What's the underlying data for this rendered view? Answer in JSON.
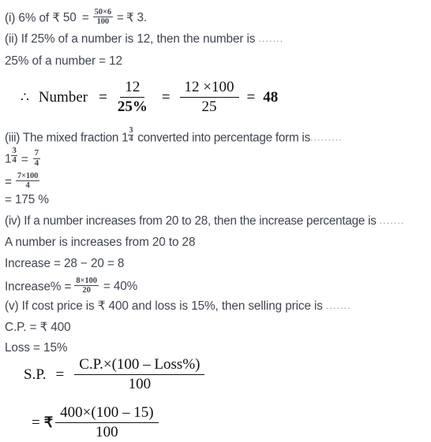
{
  "document": {
    "type": "math-solutions-worksheet",
    "text_color": "#3f4550",
    "equation_color": "#111111",
    "background": "#ffffff"
  },
  "items": {
    "i": {
      "prefix": "(i) 6% of ",
      "currency": "₹",
      "amount": "50",
      "equals1": "=",
      "fraction": {
        "numerator": "50×6",
        "denominator": "100"
      },
      "equals2": "=",
      "result": "3."
    },
    "ii": {
      "question": "(ii) If 25% of a number is 12, then the number is",
      "dots": ".......",
      "given": "25% of a number = 12",
      "equation": {
        "therefore": "∴",
        "label": "Number",
        "eq1": "=",
        "frac1": {
          "numerator": "12",
          "denominator": "25%"
        },
        "eq2": "=",
        "frac2": {
          "numerator": "12 ×100",
          "denominator": "25"
        },
        "eq3": "=",
        "answer": "48"
      }
    },
    "iii": {
      "question_before": "(iii) The mixed fraction 1",
      "mixed_fraction": {
        "whole": "1",
        "numerator": "3",
        "denominator": "4"
      },
      "question_after": " converted into percentage form is",
      "dots": ".........",
      "step1": {
        "whole": "1",
        "frac_left": {
          "numerator": "3",
          "denominator": "4"
        },
        "equals": "=",
        "frac_right": {
          "numerator": "7",
          "denominator": "4"
        }
      },
      "step2": {
        "equals": "=",
        "fraction": {
          "numerator": "7×100",
          "denominator": "4"
        }
      },
      "step3": "= 175 %"
    },
    "iv": {
      "question": "(iv) If a number increases from 20 to 28, then the increase percentage is",
      "dots": ".......",
      "given": "A number is increases from 20 to 28",
      "step1": "Increase = 28 − 20 = 8",
      "step2": {
        "label": "Increase% =",
        "fraction": {
          "numerator": "8×100",
          "denominator": "20"
        },
        "result": "= 40%"
      }
    },
    "v": {
      "question_before": "(v) If cost price is ",
      "currency": "₹",
      "question_after": " 400 and loss is 15%, then selling price is",
      "dots": ".......",
      "cp_label": "C.P. = ",
      "cp_currency": "₹",
      "cp_value": " 400",
      "loss": "Loss = 15%",
      "formula": {
        "label": "S.P.",
        "equals": "=",
        "numerator": "C.P.×(100 – Loss%)",
        "denominator": "100"
      },
      "substitution": {
        "equals": "=",
        "currency": "₹",
        "numerator": "400×(100 – 15)",
        "denominator": "100"
      }
    }
  }
}
